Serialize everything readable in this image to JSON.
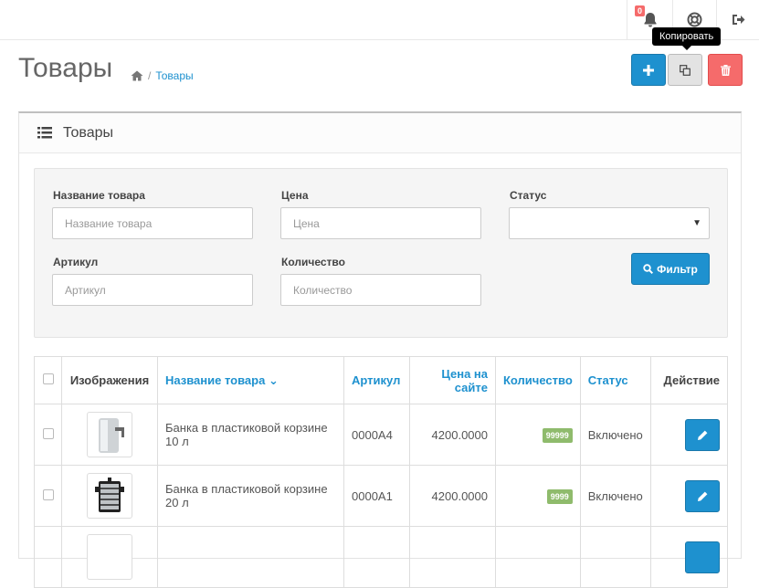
{
  "topbar": {
    "notifications_count": "0",
    "icons": [
      "bell-icon",
      "lifebuoy-icon",
      "sign-out-icon"
    ]
  },
  "header": {
    "title": "Товары",
    "breadcrumb": {
      "home_icon": "home-icon",
      "current": "Товары"
    },
    "tooltip": "Копировать",
    "buttons": {
      "add_icon": "plus-icon",
      "copy_icon": "copy-icon",
      "delete_icon": "trash-icon"
    }
  },
  "panel": {
    "heading": "Товары",
    "heading_icon": "list-icon"
  },
  "filter": {
    "name_label": "Название товара",
    "name_placeholder": "Название товара",
    "price_label": "Цена",
    "price_placeholder": "Цена",
    "status_label": "Статус",
    "status_value": "",
    "sku_label": "Артикул",
    "sku_placeholder": "Артикул",
    "qty_label": "Количество",
    "qty_placeholder": "Количество",
    "filter_button": "Фильтр"
  },
  "table": {
    "columns": {
      "image": "Изображения",
      "name": "Название товара",
      "sku": "Артикул",
      "price": "Цена на сайте",
      "qty": "Количество",
      "status": "Статус",
      "action": "Действие"
    },
    "rows": [
      {
        "name": "Банка в пластиковой корзине 10 л",
        "sku": "0000A4",
        "price": "4200.0000",
        "qty": "99999",
        "status": "Включено"
      },
      {
        "name": "Банка в пластиковой корзине 20 л",
        "sku": "0000A1",
        "price": "4200.0000",
        "qty": "9999",
        "status": "Включено"
      }
    ]
  },
  "colors": {
    "primary": "#1e91cf",
    "danger": "#f56b6b",
    "success": "#8fbb6c"
  }
}
